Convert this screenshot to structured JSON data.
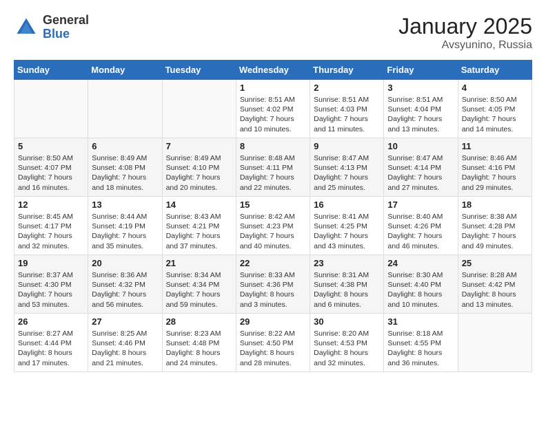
{
  "header": {
    "logo": {
      "general": "General",
      "blue": "Blue"
    },
    "title": "January 2025",
    "location": "Avsyunino, Russia"
  },
  "weekdays": [
    "Sunday",
    "Monday",
    "Tuesday",
    "Wednesday",
    "Thursday",
    "Friday",
    "Saturday"
  ],
  "weeks": [
    [
      {
        "day": "",
        "info": ""
      },
      {
        "day": "",
        "info": ""
      },
      {
        "day": "",
        "info": ""
      },
      {
        "day": "1",
        "info": "Sunrise: 8:51 AM\nSunset: 4:02 PM\nDaylight: 7 hours\nand 10 minutes."
      },
      {
        "day": "2",
        "info": "Sunrise: 8:51 AM\nSunset: 4:03 PM\nDaylight: 7 hours\nand 11 minutes."
      },
      {
        "day": "3",
        "info": "Sunrise: 8:51 AM\nSunset: 4:04 PM\nDaylight: 7 hours\nand 13 minutes."
      },
      {
        "day": "4",
        "info": "Sunrise: 8:50 AM\nSunset: 4:05 PM\nDaylight: 7 hours\nand 14 minutes."
      }
    ],
    [
      {
        "day": "5",
        "info": "Sunrise: 8:50 AM\nSunset: 4:07 PM\nDaylight: 7 hours\nand 16 minutes."
      },
      {
        "day": "6",
        "info": "Sunrise: 8:49 AM\nSunset: 4:08 PM\nDaylight: 7 hours\nand 18 minutes."
      },
      {
        "day": "7",
        "info": "Sunrise: 8:49 AM\nSunset: 4:10 PM\nDaylight: 7 hours\nand 20 minutes."
      },
      {
        "day": "8",
        "info": "Sunrise: 8:48 AM\nSunset: 4:11 PM\nDaylight: 7 hours\nand 22 minutes."
      },
      {
        "day": "9",
        "info": "Sunrise: 8:47 AM\nSunset: 4:13 PM\nDaylight: 7 hours\nand 25 minutes."
      },
      {
        "day": "10",
        "info": "Sunrise: 8:47 AM\nSunset: 4:14 PM\nDaylight: 7 hours\nand 27 minutes."
      },
      {
        "day": "11",
        "info": "Sunrise: 8:46 AM\nSunset: 4:16 PM\nDaylight: 7 hours\nand 29 minutes."
      }
    ],
    [
      {
        "day": "12",
        "info": "Sunrise: 8:45 AM\nSunset: 4:17 PM\nDaylight: 7 hours\nand 32 minutes."
      },
      {
        "day": "13",
        "info": "Sunrise: 8:44 AM\nSunset: 4:19 PM\nDaylight: 7 hours\nand 35 minutes."
      },
      {
        "day": "14",
        "info": "Sunrise: 8:43 AM\nSunset: 4:21 PM\nDaylight: 7 hours\nand 37 minutes."
      },
      {
        "day": "15",
        "info": "Sunrise: 8:42 AM\nSunset: 4:23 PM\nDaylight: 7 hours\nand 40 minutes."
      },
      {
        "day": "16",
        "info": "Sunrise: 8:41 AM\nSunset: 4:25 PM\nDaylight: 7 hours\nand 43 minutes."
      },
      {
        "day": "17",
        "info": "Sunrise: 8:40 AM\nSunset: 4:26 PM\nDaylight: 7 hours\nand 46 minutes."
      },
      {
        "day": "18",
        "info": "Sunrise: 8:38 AM\nSunset: 4:28 PM\nDaylight: 7 hours\nand 49 minutes."
      }
    ],
    [
      {
        "day": "19",
        "info": "Sunrise: 8:37 AM\nSunset: 4:30 PM\nDaylight: 7 hours\nand 53 minutes."
      },
      {
        "day": "20",
        "info": "Sunrise: 8:36 AM\nSunset: 4:32 PM\nDaylight: 7 hours\nand 56 minutes."
      },
      {
        "day": "21",
        "info": "Sunrise: 8:34 AM\nSunset: 4:34 PM\nDaylight: 7 hours\nand 59 minutes."
      },
      {
        "day": "22",
        "info": "Sunrise: 8:33 AM\nSunset: 4:36 PM\nDaylight: 8 hours\nand 3 minutes."
      },
      {
        "day": "23",
        "info": "Sunrise: 8:31 AM\nSunset: 4:38 PM\nDaylight: 8 hours\nand 6 minutes."
      },
      {
        "day": "24",
        "info": "Sunrise: 8:30 AM\nSunset: 4:40 PM\nDaylight: 8 hours\nand 10 minutes."
      },
      {
        "day": "25",
        "info": "Sunrise: 8:28 AM\nSunset: 4:42 PM\nDaylight: 8 hours\nand 13 minutes."
      }
    ],
    [
      {
        "day": "26",
        "info": "Sunrise: 8:27 AM\nSunset: 4:44 PM\nDaylight: 8 hours\nand 17 minutes."
      },
      {
        "day": "27",
        "info": "Sunrise: 8:25 AM\nSunset: 4:46 PM\nDaylight: 8 hours\nand 21 minutes."
      },
      {
        "day": "28",
        "info": "Sunrise: 8:23 AM\nSunset: 4:48 PM\nDaylight: 8 hours\nand 24 minutes."
      },
      {
        "day": "29",
        "info": "Sunrise: 8:22 AM\nSunset: 4:50 PM\nDaylight: 8 hours\nand 28 minutes."
      },
      {
        "day": "30",
        "info": "Sunrise: 8:20 AM\nSunset: 4:53 PM\nDaylight: 8 hours\nand 32 minutes."
      },
      {
        "day": "31",
        "info": "Sunrise: 8:18 AM\nSunset: 4:55 PM\nDaylight: 8 hours\nand 36 minutes."
      },
      {
        "day": "",
        "info": ""
      }
    ]
  ]
}
